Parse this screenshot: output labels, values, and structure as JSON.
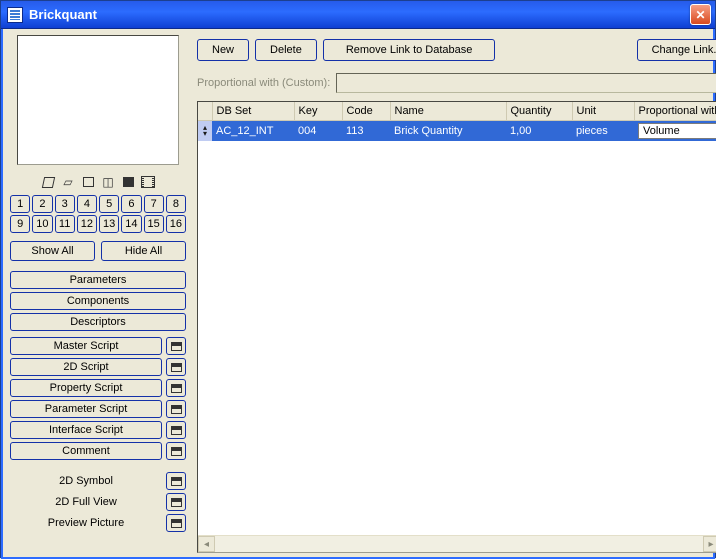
{
  "window": {
    "title": "Brickquant"
  },
  "toolbar": {
    "new": "New",
    "delete": "Delete",
    "remove_link": "Remove Link to Database",
    "change_link": "Change Link..."
  },
  "proportional_label": "Proportional with (Custom):",
  "proportional_value": "",
  "columns": {
    "handle": "",
    "dbset": "DB Set",
    "key": "Key",
    "code": "Code",
    "name": "Name",
    "quantity": "Quantity",
    "unit": "Unit",
    "prop": "Proportional with"
  },
  "rows": [
    {
      "dbset": "AC_12_INT",
      "key": "004",
      "code": "113",
      "name": "Brick Quantity",
      "quantity": "1,00",
      "unit": "pieces",
      "proportional_with": "Volume"
    }
  ],
  "side": {
    "numbers_row1": [
      "1",
      "2",
      "3",
      "4",
      "5",
      "6",
      "7",
      "8"
    ],
    "numbers_row2": [
      "9",
      "10",
      "11",
      "12",
      "13",
      "14",
      "15",
      "16"
    ],
    "show_all": "Show All",
    "hide_all": "Hide All",
    "categories": [
      "Parameters",
      "Components",
      "Descriptors"
    ],
    "scripts": [
      "Master Script",
      "2D Script",
      "Property Script",
      "Parameter Script",
      "Interface Script",
      "Comment"
    ],
    "extras": [
      "2D Symbol",
      "2D Full View",
      "Preview Picture"
    ]
  }
}
